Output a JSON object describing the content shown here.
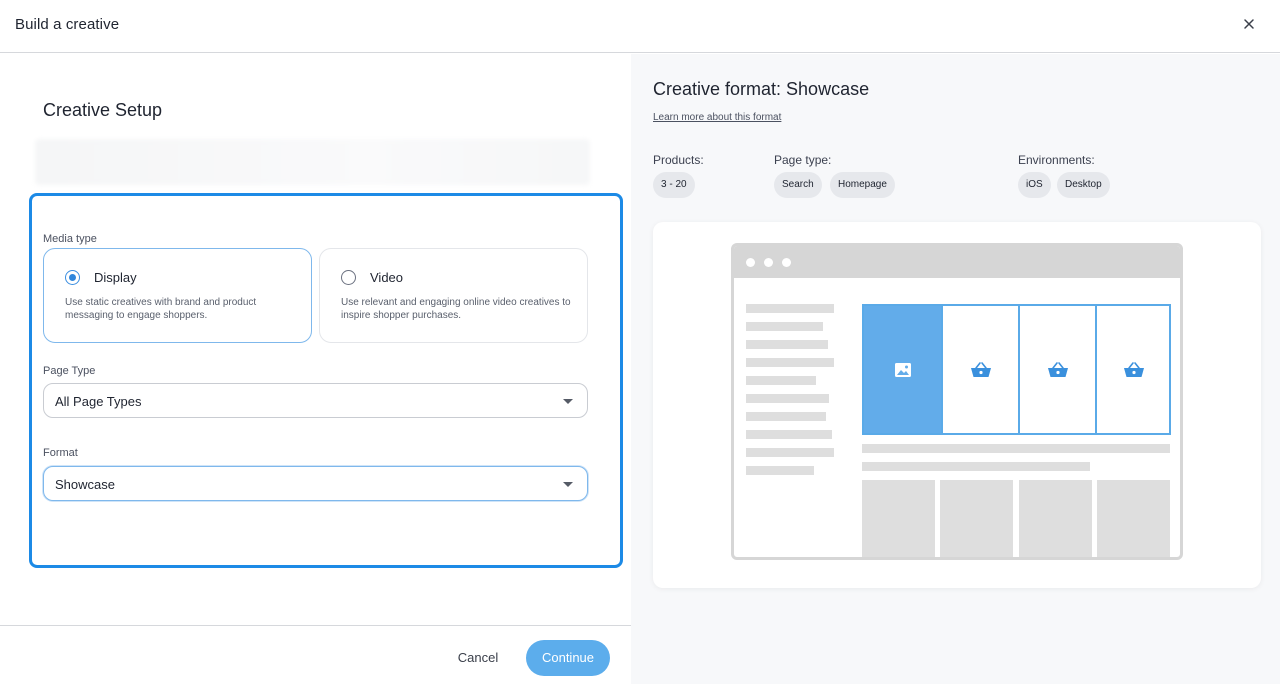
{
  "modal": {
    "title": "Build a creative"
  },
  "setup": {
    "title": "Creative Setup",
    "media_type_label": "Media type",
    "media_options": [
      {
        "title": "Display",
        "description": "Use static creatives with brand and product messaging to engage shoppers.",
        "selected": true
      },
      {
        "title": "Video",
        "description": "Use relevant and engaging online video creatives to inspire shopper purchases.",
        "selected": false
      }
    ],
    "page_type_label": "Page Type",
    "page_type_value": "All Page Types",
    "format_label": "Format",
    "format_value": "Showcase"
  },
  "footer": {
    "cancel_label": "Cancel",
    "continue_label": "Continue"
  },
  "format_info": {
    "title": "Creative format: Showcase",
    "learn_more": "Learn more about this format",
    "products_label": "Products:",
    "products": [
      "3 - 20"
    ],
    "page_type_label": "Page type:",
    "page_types": [
      "Search",
      "Homepage"
    ],
    "environments_label": "Environments:",
    "environments": [
      "iOS",
      "Desktop"
    ]
  },
  "colors": {
    "accent": "#1c8ae6",
    "continue_bg": "#5cadec",
    "tile_highlight": "#62acea"
  },
  "icons": {
    "close": "close-icon",
    "image": "image-icon",
    "basket": "basket-icon"
  }
}
